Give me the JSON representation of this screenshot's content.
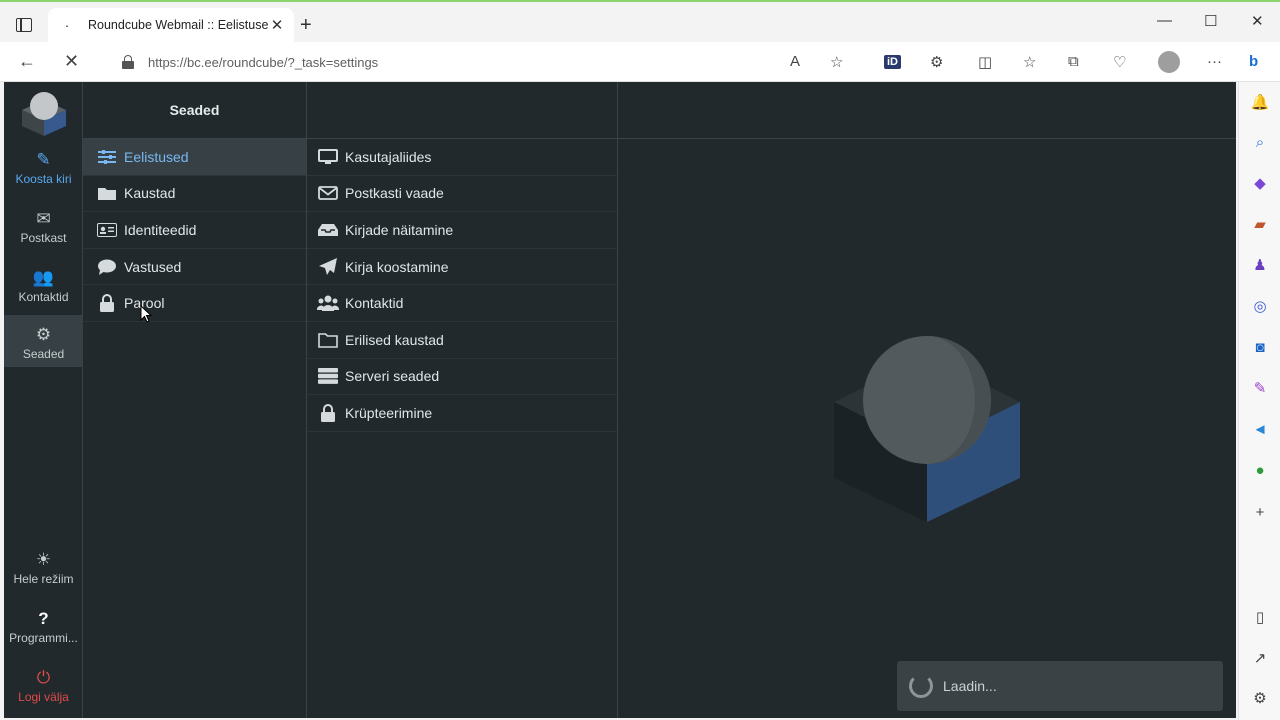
{
  "browser": {
    "tab_title": "Roundcube Webmail :: Eelistused",
    "url": "https://bc.ee/roundcube/?_task=settings"
  },
  "rail": {
    "compose": "Koosta kiri",
    "mail": "Postkast",
    "contacts": "Kontaktid",
    "settings": "Seaded",
    "theme": "Hele režiim",
    "about": "Programmi...",
    "logout": "Logi välja"
  },
  "settings_col": {
    "title": "Seaded",
    "items": [
      {
        "label": "Eelistused",
        "icon": "sliders-icon"
      },
      {
        "label": "Kaustad",
        "icon": "folder-icon"
      },
      {
        "label": "Identiteedid",
        "icon": "id-card-icon"
      },
      {
        "label": "Vastused",
        "icon": "comment-icon"
      },
      {
        "label": "Parool",
        "icon": "lock-icon"
      }
    ]
  },
  "prefs_col": {
    "items": [
      {
        "label": "Kasutajaliides",
        "icon": "monitor-icon"
      },
      {
        "label": "Postkasti vaade",
        "icon": "envelope-icon"
      },
      {
        "label": "Kirjade näitamine",
        "icon": "inbox-icon"
      },
      {
        "label": "Kirja koostamine",
        "icon": "paper-plane-icon"
      },
      {
        "label": "Kontaktid",
        "icon": "users-icon"
      },
      {
        "label": "Erilised kaustad",
        "icon": "folder-outline-icon"
      },
      {
        "label": "Serveri seaded",
        "icon": "server-icon"
      },
      {
        "label": "Krüpteerimine",
        "icon": "lock-icon"
      }
    ]
  },
  "status": {
    "loading": "Laadin..."
  },
  "colors": {
    "app_bg": "#21292c",
    "accent": "#58a8f0",
    "logout": "#e04b4b"
  }
}
